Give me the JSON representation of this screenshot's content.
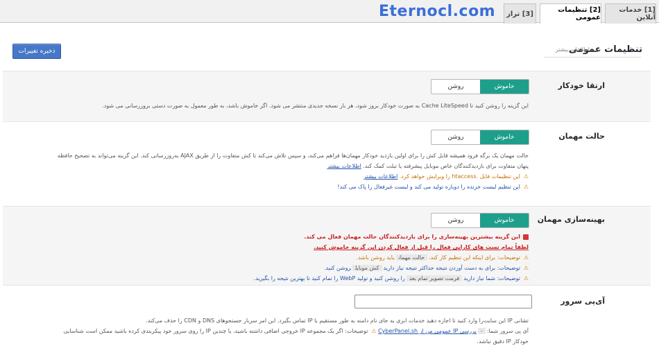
{
  "watermark": "Eternocl.com",
  "tabs": [
    {
      "label": "[1] خدمات آنلاین",
      "active": false
    },
    {
      "label": "[2] تنظیمات عمومی",
      "active": true
    },
    {
      "label": "[3] تراز",
      "active": false
    }
  ],
  "header": {
    "title": "تنظیمات عمومی",
    "subtitle": "اطلاعات بیشتر",
    "save_label": "ذخیره تغییرات"
  },
  "toggle": {
    "on_label": "روشن",
    "off_label": "خاموش"
  },
  "sections": {
    "auto_upgrade": {
      "label": "ارتقا خودکار",
      "desc": "این گزینه را روشن کنید تا Cache LiteSpeed به صورت خودکار بروز شود، هر بار نسخه جدیدی منتشر می شود. اگر خاموش باشد، به طور معمول به صورت دستی بروزرسانی می شود."
    },
    "guest_mode": {
      "label": "حالت مهمان",
      "desc1": "حالت مهمان یک برگه فرود همیشه قابل کش را برای اولین بازدید خودکار مهمان‌ها فراهم می‌کند، و سپس تلاش می‌کند تا کش متفاوت را از طریق AJAX به‌روزرسانی کند. این گزینه می‌تواند به تصحیح حافظه",
      "desc2": "پنهان متفاوت برای بازدیدکنندگان خاص موبایل پیشرفته یا تبلت کمک کند.",
      "learn_more": "اطلاعات بیشتر",
      "warn1": "این تنظیمات فایل .htaccess را ویرایش خواهد کرد.",
      "warn1_link": "اطلاعات بیشتر",
      "warn2": "این تنظیم لیست خزنده را دوباره تولید می کند و لیست غیرفعال را پاک می کند!"
    },
    "guest_optimization": {
      "label": "بهینه‌سازی مهمان",
      "red1": "این گزینه بیشترین بهینه‌سازی را برای بازدیدکنندگان حالت مهمان فعال می کند.",
      "red2": "لطفاً تمام تست های کارایی فعال را قبل از فعال کردن این گزینه خاموش کنید.",
      "note1_pre": "توضیحات: برای اینکه این تنظیم کار کند،",
      "note1_code": "حالت مهمان",
      "note1_post": "باید روشن باشد.",
      "note2_pre": "توضیحات: برای به دست آوردن نتیجه حداکثر نتیجه نیاز دارید",
      "note2_code": "کش موبایل",
      "note2_post": "روشن کنید.",
      "note3_pre": "توضیحات: شما نیاز دارید",
      "note3_code": "فرمت تصویر تمام بعد",
      "note3_post": "را روشن کنید و تولید WebP را تمام کنید تا بهترین نتیجه را بگیرید."
    },
    "server_ip": {
      "label": "آی‌پی سرور",
      "input_value": "",
      "desc1": "تشانی IP این سایت‌را وارد کنید تا اجازه دهید خدمات ابری به جای نام دامنه به طور مستقیم با IP تماس بگیرد. این امر سربار جستجوهای DNS و CDN را حذف می‌کند.",
      "desc2_pre": "آی پی سرور شما:",
      "desc2_code": "-",
      "desc2_link": "بررسی IP عمومی من از CyberPanel.sh",
      "desc2_post": "توضیحات: اگر یک مجموعه IP خروجی اضافی داشته باشید، یا چندین IP را روی سرور خود پیکربندی کرده باشید ممکن است شناسایی",
      "desc3": "خودکار IP دقیق نباشد."
    }
  }
}
